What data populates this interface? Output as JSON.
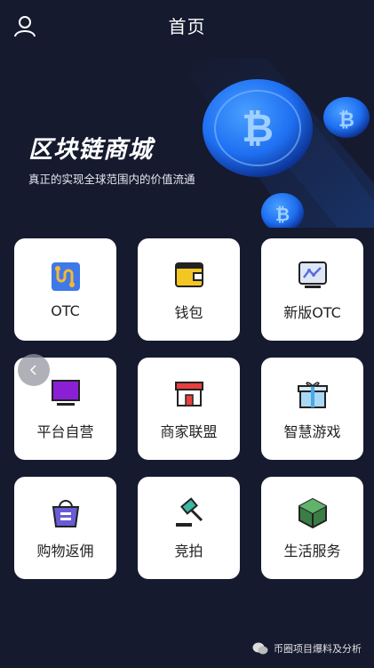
{
  "header": {
    "title": "首页"
  },
  "hero": {
    "title": "区块链商城",
    "subtitle": "真正的实现全球范围内的价值流通"
  },
  "grid": {
    "items": [
      {
        "label": "OTC",
        "icon": "puzzle-route-icon"
      },
      {
        "label": "钱包",
        "icon": "wallet-icon"
      },
      {
        "label": "新版OTC",
        "icon": "chart-monitor-icon"
      },
      {
        "label": "平台自营",
        "icon": "tv-monitor-icon"
      },
      {
        "label": "商家联盟",
        "icon": "storefront-icon"
      },
      {
        "label": "智慧游戏",
        "icon": "gift-box-icon"
      },
      {
        "label": "购物返佣",
        "icon": "shopping-bag-icon"
      },
      {
        "label": "竞拍",
        "icon": "auction-hammer-icon"
      },
      {
        "label": "生活服务",
        "icon": "package-box-icon"
      }
    ]
  },
  "footer": {
    "watermark": "币圈项目爆料及分析"
  },
  "colors": {
    "background": "#161a2f",
    "coin_blue": "#1f6ff2",
    "card": "#ffffff"
  }
}
